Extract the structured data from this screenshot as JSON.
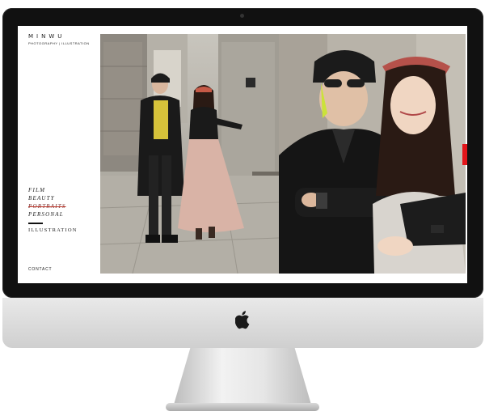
{
  "site": {
    "logo": "MINWU",
    "tagline": "PHOTOGRAPHY | ILLUSTRATION"
  },
  "nav": {
    "items": [
      {
        "label": "FILM"
      },
      {
        "label": "BEAUTY"
      },
      {
        "label": "PORTRAITS",
        "active": true
      },
      {
        "label": "PERSONAL"
      }
    ],
    "secondary": "ILLUSTRATION"
  },
  "footer": {
    "contact": "CONTACT"
  },
  "icons": {
    "apple": "apple-logo-icon"
  },
  "colors": {
    "accent_red": "#e3151a",
    "active_nav": "#7a2d2d"
  }
}
